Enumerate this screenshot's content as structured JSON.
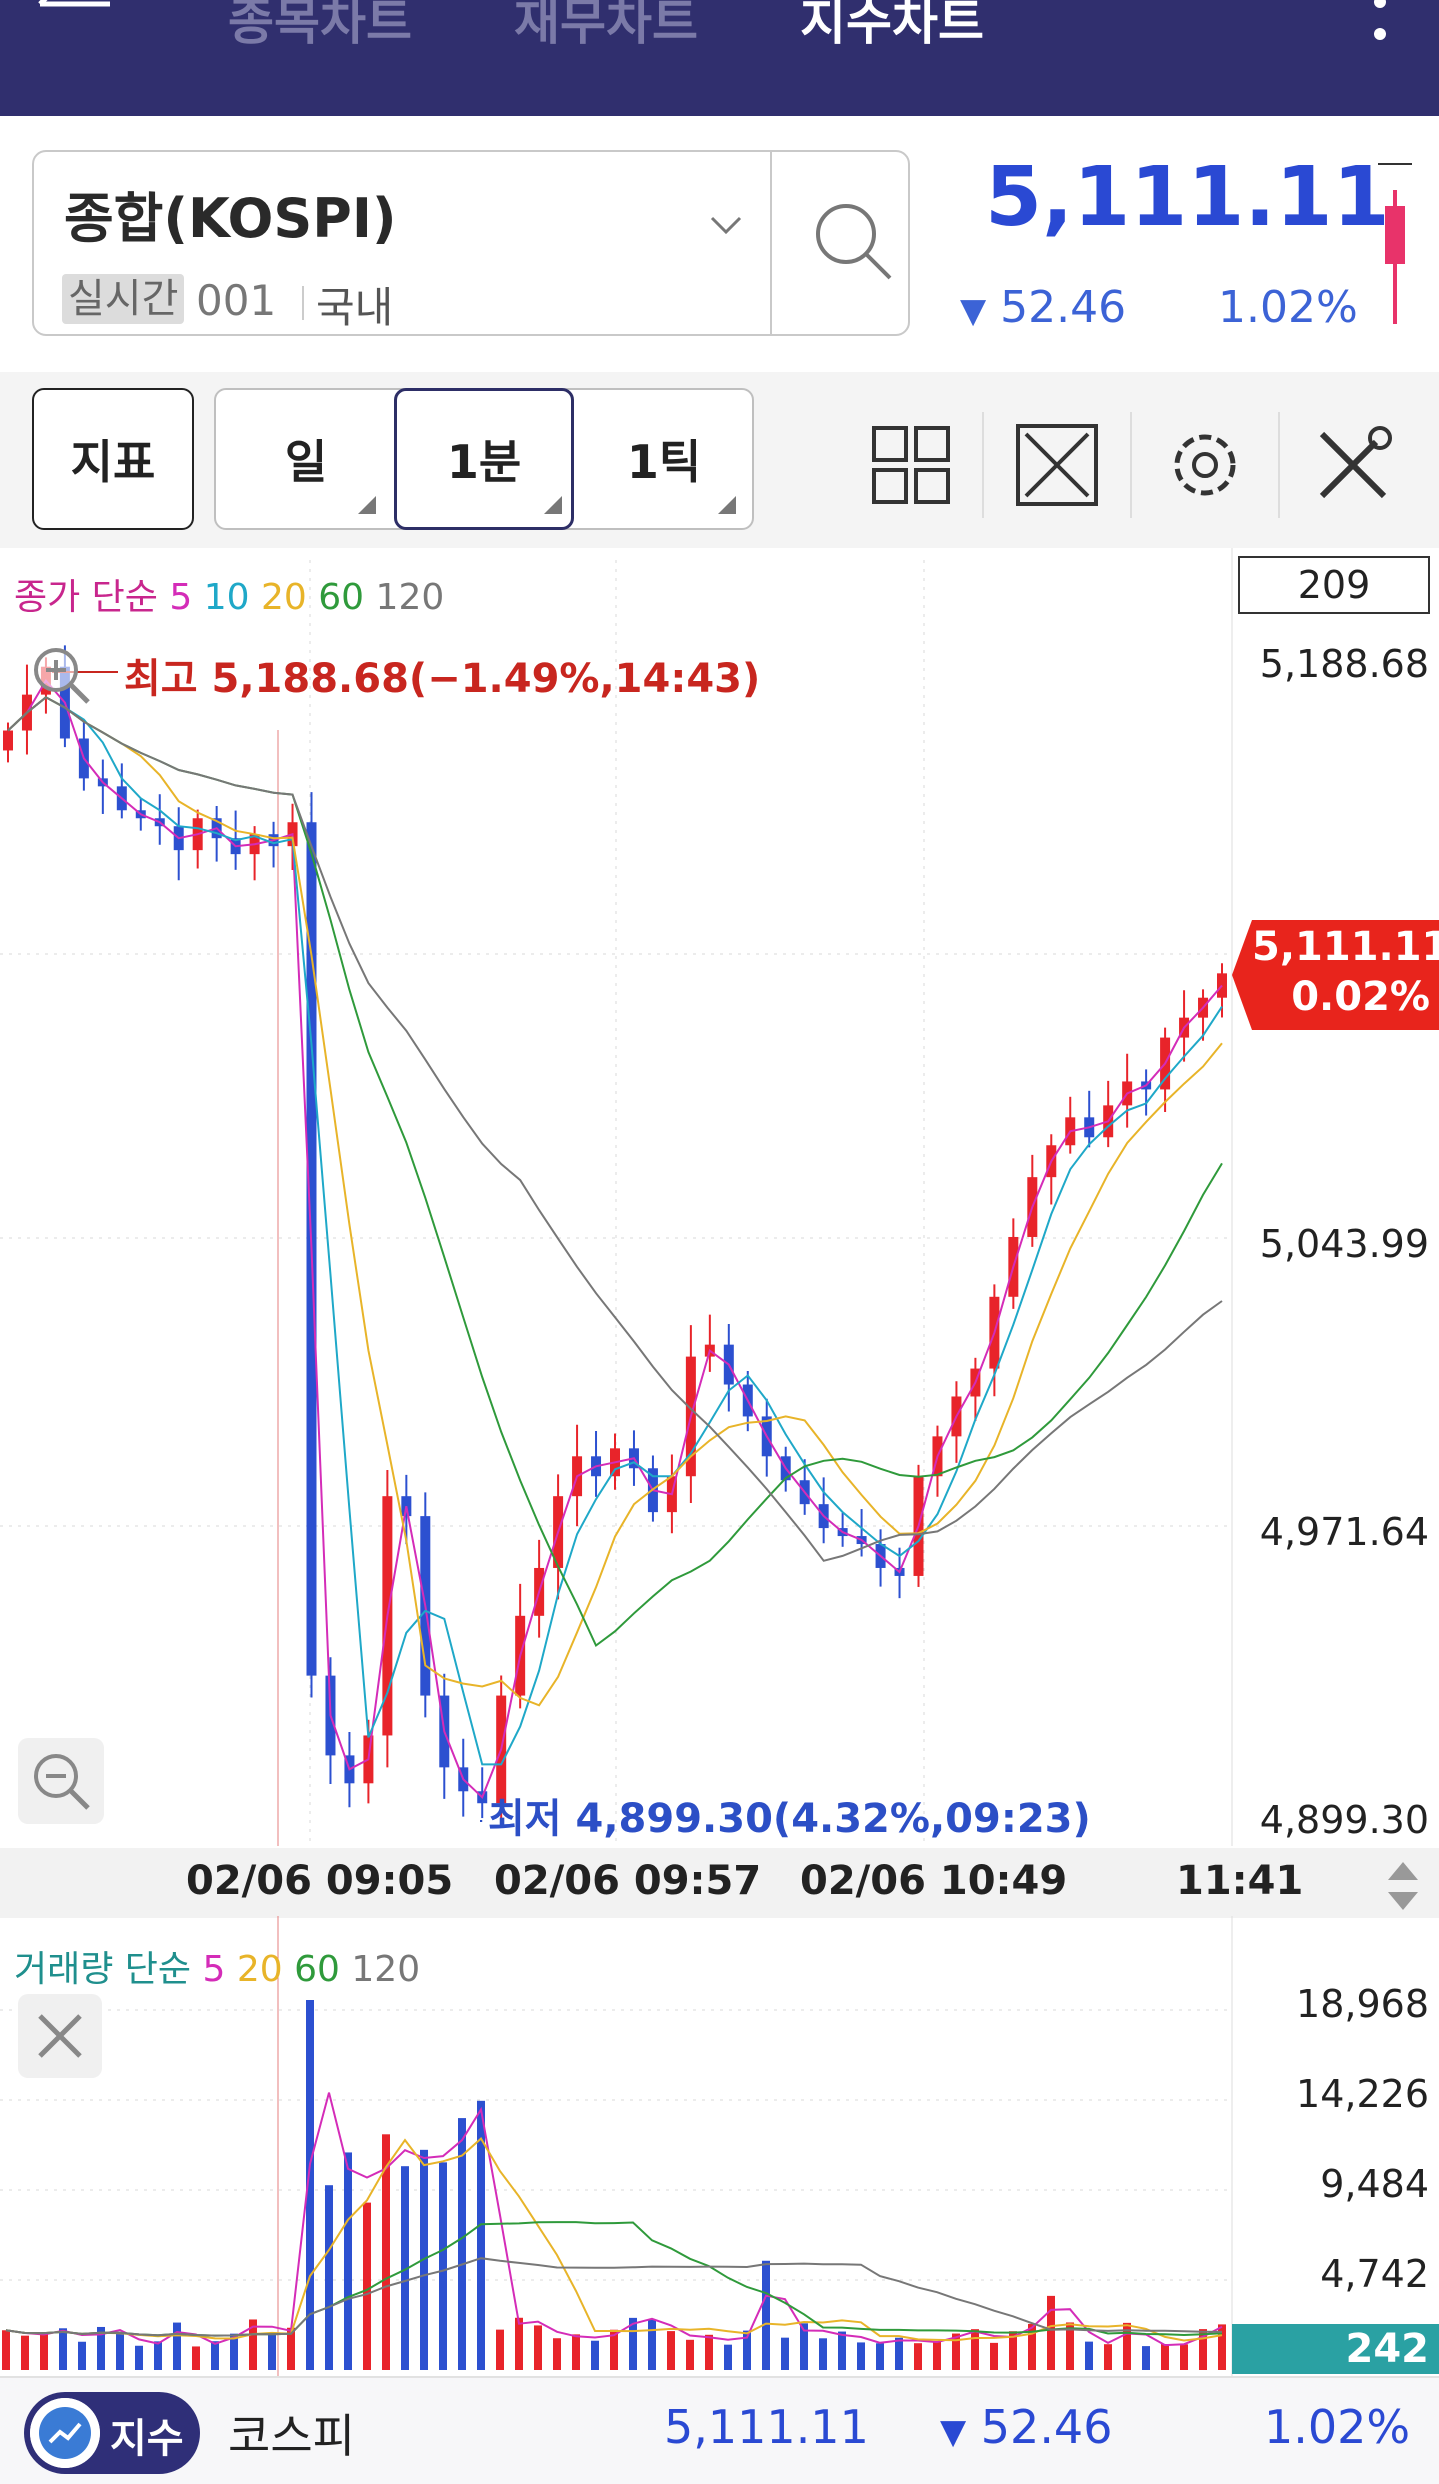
{
  "nav": {
    "tabs": [
      {
        "label": "종목차트",
        "active": false
      },
      {
        "label": "재무차트",
        "active": false
      },
      {
        "label": "지수차트",
        "active": true
      }
    ]
  },
  "symbol": {
    "name": "종합(KOSPI)",
    "realtime_badge": "실시간",
    "code": "001",
    "market": "국내"
  },
  "quote": {
    "price": "5,111.11",
    "change_arrow": "▼",
    "change": "52.46",
    "change_pct": "1.02%"
  },
  "toolbar": {
    "indicator_label": "지표",
    "periods": [
      {
        "label": "일",
        "selected": false
      },
      {
        "label": "1분",
        "selected": true
      },
      {
        "label": "1틱",
        "selected": false
      }
    ],
    "icons": [
      "grid-layout-icon",
      "expand-icon",
      "gear-icon",
      "tools-icon"
    ]
  },
  "price_chart": {
    "legend": {
      "title": "종가 단순",
      "ma": [
        "5",
        "10",
        "20",
        "60",
        "120"
      ]
    },
    "count": "209",
    "y_ticks": [
      "5,188.68",
      "5,043.99",
      "4,971.64",
      "4,899.30"
    ],
    "current_price": "5,111.11",
    "current_pct": "0.02%",
    "high_label": "최고 5,188.68(−1.49%,14:43)",
    "low_label": "최저 4,899.30(4.32%,09:23)",
    "x_ticks": [
      "02/06 09:05",
      "02/06 09:57",
      "02/06 10:49",
      "11:41"
    ]
  },
  "volume_chart": {
    "legend": {
      "title": "거래량 단순",
      "ma": [
        "5",
        "20",
        "60",
        "120"
      ]
    },
    "y_ticks": [
      "18,968",
      "14,226",
      "9,484",
      "4,742"
    ],
    "current_volume": "242"
  },
  "bottom_bar": {
    "pill_label": "지수",
    "name": "코스피",
    "price": "5,111.11",
    "change_arrow": "▼",
    "change": "52.46",
    "change_pct": "1.02%"
  },
  "colors": {
    "header_bg": "#302f6e",
    "price_blue": "#2a49d3",
    "up_red": "#e8242a",
    "down_blue": "#2c50d0",
    "ma5": "#d42cb8",
    "ma10": "#1fa8c8",
    "ma20": "#e8b429",
    "ma60": "#2f9a3b",
    "ma120": "#777777"
  },
  "chart_data": {
    "type": "candlestick",
    "y_range": [
      4899.3,
      5188.68
    ],
    "close_series": [
      5172,
      5181,
      5188,
      5170,
      5160,
      5158,
      5152,
      5150,
      5148,
      5142,
      5150,
      5145,
      5141,
      5146,
      5143,
      5149,
      4935,
      4915,
      4908,
      4920,
      4980,
      4975,
      4930,
      4912,
      4906,
      4903,
      4930,
      4950,
      4962,
      4980,
      4990,
      4985,
      4992,
      4987,
      4976,
      4985,
      5015,
      5018,
      5008,
      5000,
      4990,
      4984,
      4978,
      4972,
      4970,
      4968,
      4962,
      4960,
      4985,
      4995,
      5005,
      5012,
      5030,
      5045,
      5060,
      5068,
      5075,
      5070,
      5078,
      5084,
      5082,
      5095,
      5100,
      5105,
      5111.11
    ]
  }
}
